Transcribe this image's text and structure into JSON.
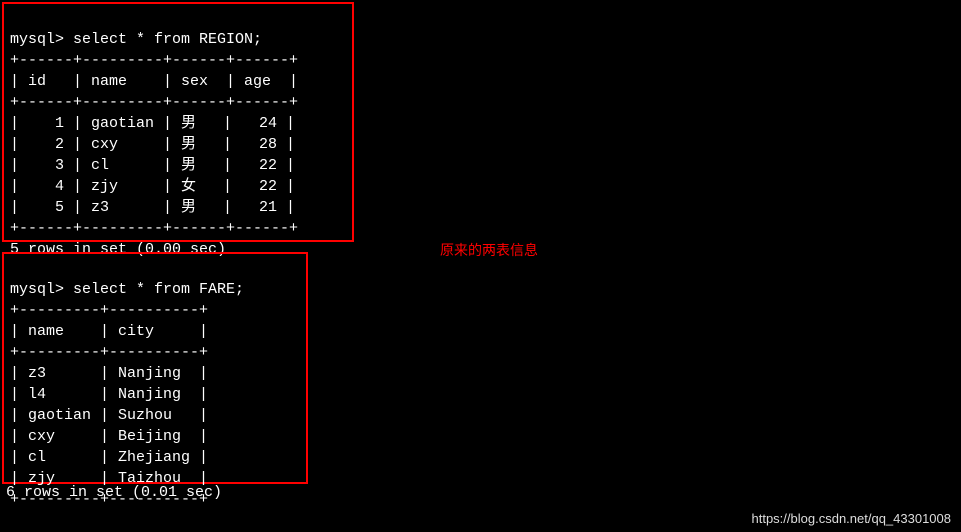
{
  "annotation": "原来的两表信息",
  "watermark": "https://blog.csdn.net/qq_43301008",
  "query1": {
    "prompt": "mysql> ",
    "sql": "select * from REGION;",
    "border_top": "+------+---------+------+------+",
    "header_row": "| id   | name    | sex  | age  |",
    "border_mid": "+------+---------+------+------+",
    "rows": [
      "|    1 | gaotian | 男   |   24 |",
      "|    2 | cxy     | 男   |   28 |",
      "|    3 | cl      | 男   |   22 |",
      "|    4 | zjy     | 女   |   22 |",
      "|    5 | z3      | 男   |   21 |"
    ],
    "border_bot": "+------+---------+------+------+",
    "footer": "5 rows in set (0.00 sec)"
  },
  "query2": {
    "prompt": "mysql> ",
    "sql": "select * from FARE;",
    "border_top": "+---------+----------+",
    "header_row": "| name    | city     |",
    "border_mid": "+---------+----------+",
    "rows": [
      "| z3      | Nanjing  |",
      "| l4      | Nanjing  |",
      "| gaotian | Suzhou   |",
      "| cxy     | Beijing  |",
      "| cl      | Zhejiang |",
      "| zjy     | Taizhou  |"
    ],
    "border_bot": "+---------+----------+",
    "footer": "6 rows in set (0.01 sec)"
  }
}
